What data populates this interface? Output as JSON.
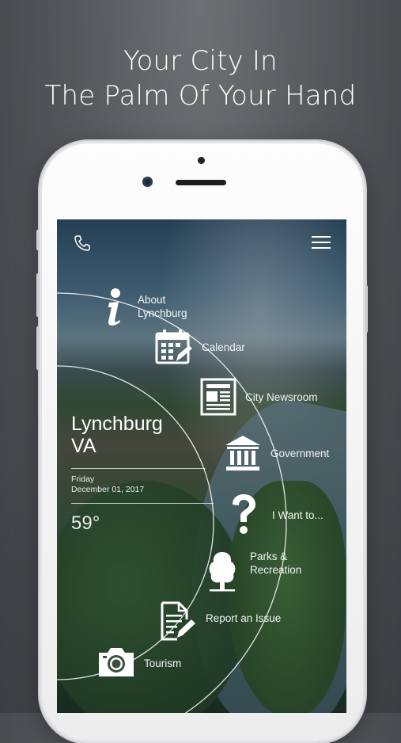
{
  "headline": {
    "line1": "Your City In",
    "line2": "The Palm Of Your Hand"
  },
  "topbar": {
    "phone_icon": "phone-icon",
    "menu_icon": "hamburger-menu-icon"
  },
  "location": {
    "city": "Lynchburg",
    "state": "VA",
    "day": "Friday",
    "date": "December 01, 2017",
    "temperature": "59°"
  },
  "menu": [
    {
      "label_line1": "About",
      "label_line2": "Lynchburg",
      "icon": "info-icon"
    },
    {
      "label_line1": "Calendar",
      "label_line2": "",
      "icon": "calendar-icon"
    },
    {
      "label_line1": "City Newsroom",
      "label_line2": "",
      "icon": "newspaper-icon"
    },
    {
      "label_line1": "Government",
      "label_line2": "",
      "icon": "government-building-icon"
    },
    {
      "label_line1": "I Want to...",
      "label_line2": "",
      "icon": "question-mark-icon"
    },
    {
      "label_line1": "Parks &",
      "label_line2": "Recreation",
      "icon": "tree-icon"
    },
    {
      "label_line1": "Report an Issue",
      "label_line2": "",
      "icon": "report-document-icon"
    },
    {
      "label_line1": "Tourism",
      "label_line2": "",
      "icon": "camera-icon"
    }
  ],
  "colors": {
    "text": "#ffffff",
    "background": "#55575a",
    "phone_body": "#f4f4f4"
  }
}
